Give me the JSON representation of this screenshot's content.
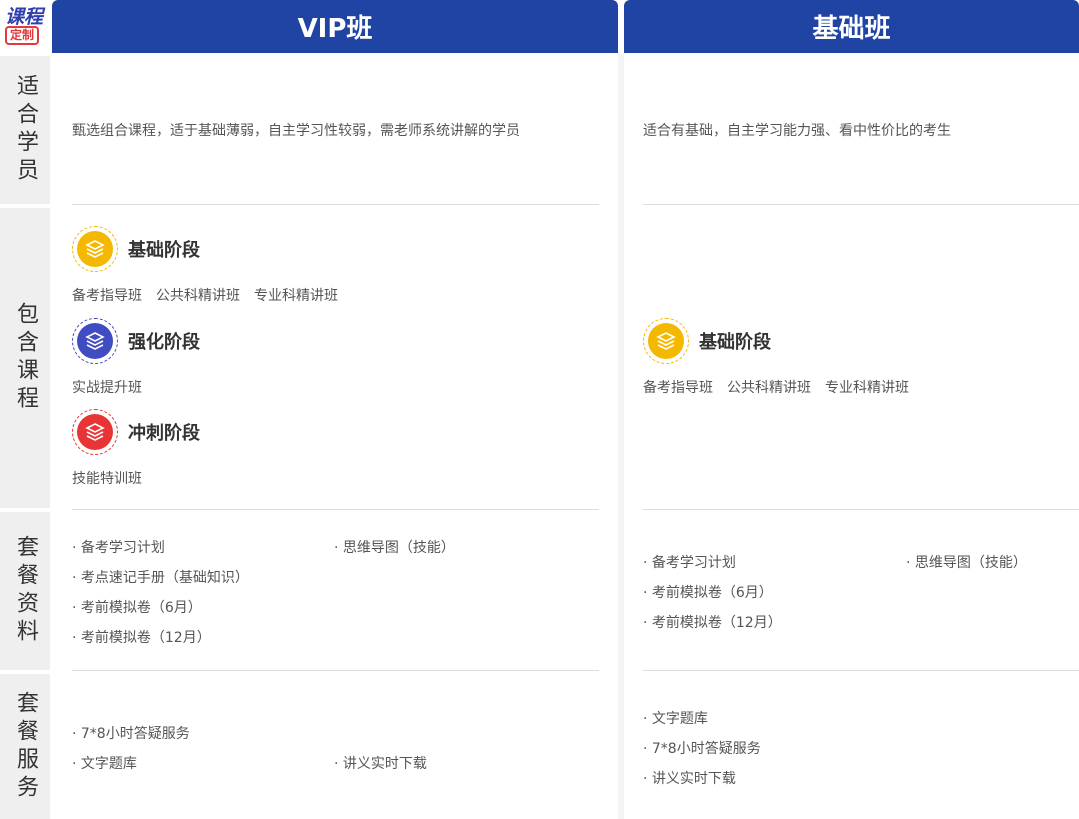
{
  "logo": {
    "line1": "课程",
    "line2": "定制"
  },
  "sidebar": [
    {
      "label": "适合学员"
    },
    {
      "label": "包含课程"
    },
    {
      "label": "套餐资料"
    },
    {
      "label": "套餐服务"
    }
  ],
  "vip": {
    "title": "VIP班",
    "suitable": "甄选组合课程，适于基础薄弱，自主学习性较弱，需老师系统讲解的学员",
    "stages": [
      {
        "name": "基础阶段",
        "icon": "layers-icon",
        "color": "#f5b800",
        "items": [
          "备考指导班",
          "公共科精讲班",
          "专业科精讲班"
        ]
      },
      {
        "name": "强化阶段",
        "icon": "layers-icon",
        "color": "#3f4cc2",
        "items": [
          "实战提升班"
        ]
      },
      {
        "name": "冲刺阶段",
        "icon": "layers-icon",
        "color": "#e83434",
        "items": [
          "技能特训班"
        ]
      }
    ],
    "materials": {
      "left": [
        "· 备考学习计划",
        "· 考点速记手册（基础知识）",
        "· 考前模拟卷（6月）",
        "· 考前模拟卷（12月）"
      ],
      "right": [
        "· 思维导图（技能）"
      ]
    },
    "services": {
      "left": [
        "· 7*8小时答疑服务",
        "· 文字题库"
      ],
      "right": [
        "· 讲义实时下载"
      ]
    }
  },
  "basic": {
    "title": "基础班",
    "suitable": "适合有基础，自主学习能力强、看中性价比的考生",
    "stages": [
      {
        "name": "基础阶段",
        "icon": "layers-icon",
        "color": "#f5b800",
        "items": [
          "备考指导班",
          "公共科精讲班",
          "专业科精讲班"
        ]
      }
    ],
    "materials": {
      "left": [
        "· 备考学习计划",
        "· 考前模拟卷（6月）",
        "· 考前模拟卷（12月）"
      ],
      "right": [
        "· 思维导图（技能）"
      ]
    },
    "services": {
      "left": [
        "· 文字题库",
        "· 7*8小时答疑服务",
        "· 讲义实时下载"
      ]
    }
  }
}
